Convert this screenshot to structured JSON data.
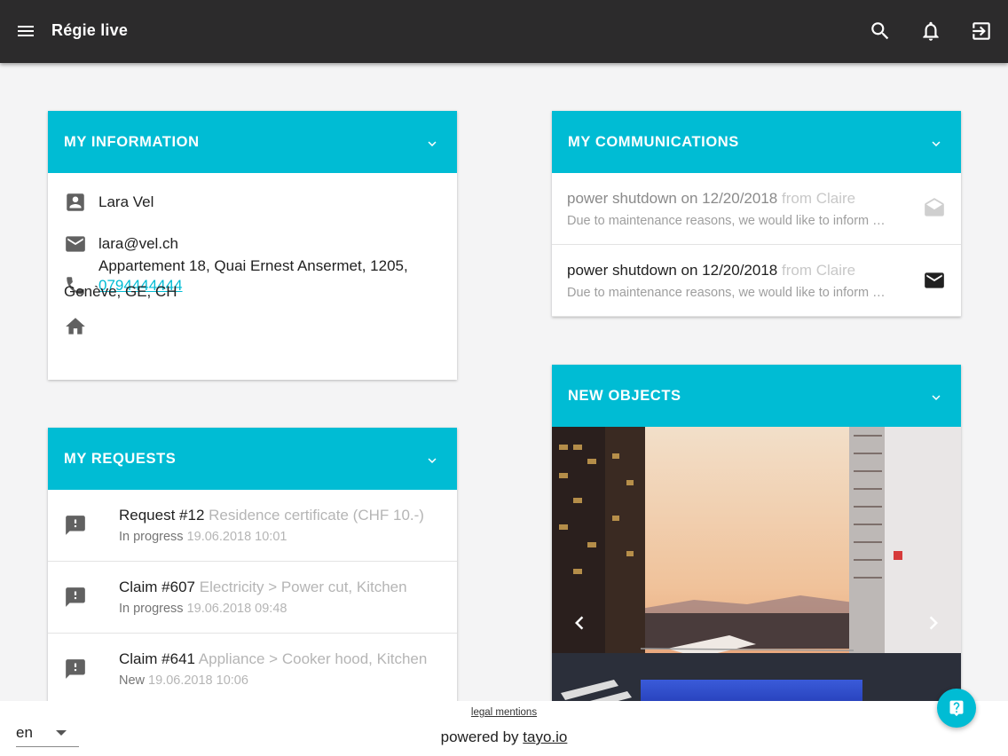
{
  "app": {
    "title": "Régie live"
  },
  "topbar_icons": [
    "menu-icon",
    "search-icon",
    "bell-icon",
    "logout-icon"
  ],
  "colors": {
    "topbar": "#2c2b2c",
    "accent": "#00bcd4",
    "background": "#f4f4f5"
  },
  "info": {
    "header": "MY INFORMATION",
    "name": "Lara Vel",
    "email": "lara@vel.ch",
    "phone": "0794444444",
    "address": "Appartement 18, Quai Ernest Ansermet, 1205, Genève, GE, CH"
  },
  "requests": {
    "header": "MY REQUESTS",
    "items": [
      {
        "title": "Request #12",
        "detail": "Residence certificate (CHF 10.-)",
        "status": "In progress",
        "date": "19.06.2018 10:01"
      },
      {
        "title": "Claim #607",
        "detail": "Electricity > Power cut, Kitchen",
        "status": "In progress",
        "date": "19.06.2018 09:48"
      },
      {
        "title": "Claim #641",
        "detail": "Appliance > Cooker hood, Kitchen",
        "status": "New",
        "date": "19.06.2018 10:06"
      }
    ]
  },
  "communications": {
    "header": "MY COMMUNICATIONS",
    "items": [
      {
        "title": "power shutdown on 12/20/2018",
        "from": "from Claire",
        "preview": "Due to maintenance reasons, we would like to inform you",
        "state": "read"
      },
      {
        "title": "power shutdown on 12/20/2018",
        "from": "from Claire",
        "preview": "Due to maintenance reasons, we would like to inform you",
        "state": "unread"
      }
    ]
  },
  "objects": {
    "header": "NEW OBJECTS"
  },
  "footer": {
    "language": "en",
    "legal": "legal mentions",
    "powered_prefix": "powered by",
    "powered_link": "tayo.io"
  }
}
